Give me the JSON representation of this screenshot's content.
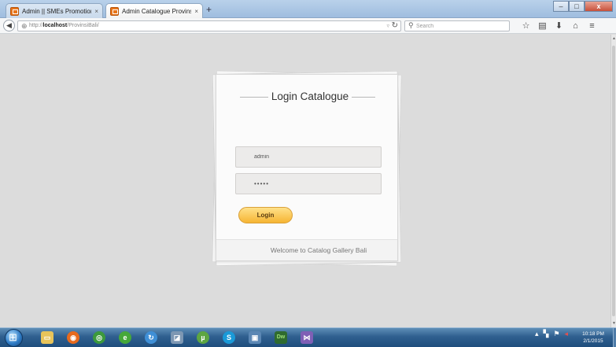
{
  "browser": {
    "tabs": [
      {
        "title": "Admin || SMEs Promotion",
        "active": false,
        "close": "×"
      },
      {
        "title": "Admin Catalogue Provinsi ...",
        "active": true,
        "close": "×"
      }
    ],
    "new_tab": "+",
    "window_controls": {
      "minimize": "–",
      "maximize": "□",
      "close": "x"
    },
    "url_prefix": "http://",
    "url_host": "localhost",
    "url_path": "/ProvinsiBali/",
    "search_placeholder": "Search",
    "toolbar_icons": [
      "bookmark-star-icon",
      "reading-list-icon",
      "download-icon",
      "home-icon",
      "menu-icon"
    ]
  },
  "login": {
    "title": "Login Catalogue",
    "username_value": "admin",
    "password_value": "•••••",
    "button_label": "Login",
    "footer_text": "Welcome to Catalog Gallery Bali"
  },
  "taskbar": {
    "apps": [
      "windows-explorer-icon",
      "firefox-icon",
      "chrome-icon",
      "edge-green-icon",
      "app-blue-icon",
      "app-gray-icon",
      "utorrent-icon",
      "skype-icon",
      "app-window-icon",
      "dreamweaver-icon",
      "visual-studio-icon"
    ],
    "clock_time": "10:18 PM",
    "clock_date": "2/1/2015"
  },
  "colors": {
    "login_button": "#f6b433",
    "page_background": "#dcdcdc",
    "taskbar": "#2f5f8f"
  }
}
